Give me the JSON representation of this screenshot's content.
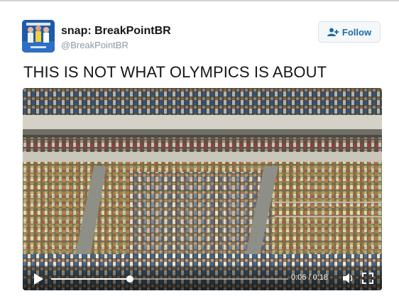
{
  "tweet": {
    "display_name": "snap: BreakPointBR",
    "handle": "@BreakPointBR",
    "text": "THIS IS NOT WHAT OLYMPICS IS ABOUT",
    "avatar_icon": "profile-photo"
  },
  "follow_button": {
    "label": "Follow",
    "icon": "add-user-icon",
    "color": "#1b6aa5"
  },
  "video": {
    "time_label": "0:06 / 0:18",
    "progress_fraction": 0.333,
    "icons": [
      "play-icon",
      "volume-icon",
      "fullscreen-icon"
    ]
  }
}
